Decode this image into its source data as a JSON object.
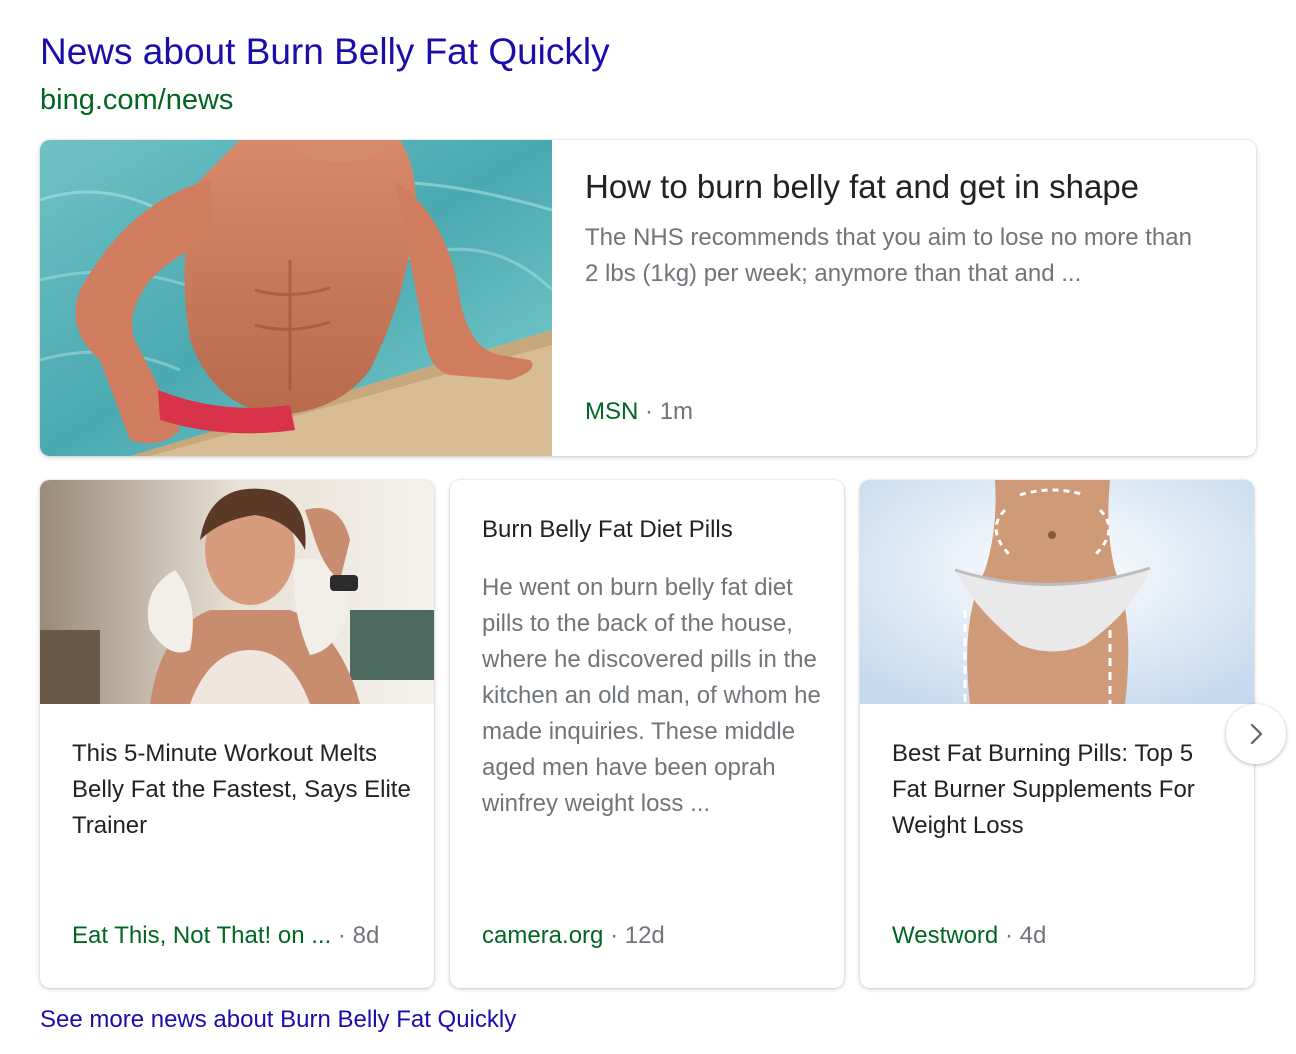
{
  "header": {
    "title": "News about Burn Belly Fat Quickly",
    "url": "bing.com/news"
  },
  "featured": {
    "image_icon": "swimmer-pool-photo",
    "title": "How to burn belly fat and get in shape",
    "snippet": "The NHS recommends that you aim to lose no more than 2 lbs (1kg) per week; anymore than that and ...",
    "source": "MSN",
    "separator": "·",
    "age": "1m"
  },
  "cards": [
    {
      "image_icon": "woman-towel-photo",
      "title": "This 5-Minute Workout Melts Belly Fat the Fastest, Says Elite Trainer",
      "source": "Eat This, Not That! on ...",
      "separator": "·",
      "age": "8d"
    },
    {
      "title": "Burn Belly Fat Diet Pills",
      "snippet": "He went on burn belly fat diet pills to the back of the house, where he discovered pills in the kitchen an old man, of whom he made inquiries. These middle aged men have been oprah winfrey weight loss ...",
      "source": "camera.org",
      "separator": "·",
      "age": "12d"
    },
    {
      "image_icon": "waist-marked-photo",
      "title": "Best Fat Burning Pills: Top 5 Fat Burner Supplements For Weight Loss",
      "source": "Westword",
      "separator": "·",
      "age": "4d"
    }
  ],
  "navigation": {
    "next_icon": "chevron-right-icon"
  },
  "footer": {
    "see_more": "See more news about Burn Belly Fat Quickly"
  },
  "colors": {
    "link": "#1a0dab",
    "url_green": "#006621",
    "text": "#222222",
    "muted": "#70757a"
  }
}
